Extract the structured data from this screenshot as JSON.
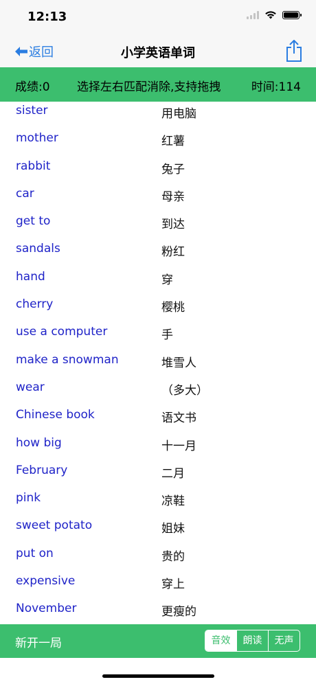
{
  "status": {
    "time": "12:13"
  },
  "nav": {
    "back_label": "返回",
    "title": "小学英语单词"
  },
  "info": {
    "score": "成绩:0",
    "hint": "选择左右匹配消除,支持拖拽",
    "time": "时间:114"
  },
  "words": {
    "english": [
      "sister",
      "mother",
      "rabbit",
      "car",
      "get to",
      "sandals",
      "hand",
      "cherry",
      "use a computer",
      "make a snowman",
      "wear",
      "Chinese book",
      "how big",
      "February",
      "pink",
      "sweet potato",
      "put on",
      "expensive",
      "November"
    ],
    "chinese": [
      "用电脑",
      "红薯",
      "兔子",
      "母亲",
      "到达",
      "粉红",
      "穿",
      "樱桃",
      "手",
      "堆雪人",
      "（多大）",
      "语文书",
      "十一月",
      "二月",
      "凉鞋",
      "姐妹",
      "贵的",
      "穿上",
      "更瘦的"
    ]
  },
  "bottom": {
    "new_game": "新开一局",
    "sound_options": [
      "音效",
      "朗读",
      "无声"
    ],
    "selected_option": "音效"
  },
  "colors": {
    "accent_green": "#3cbe6e",
    "english_blue": "#1f23c8",
    "nav_blue": "#2a7de1"
  }
}
